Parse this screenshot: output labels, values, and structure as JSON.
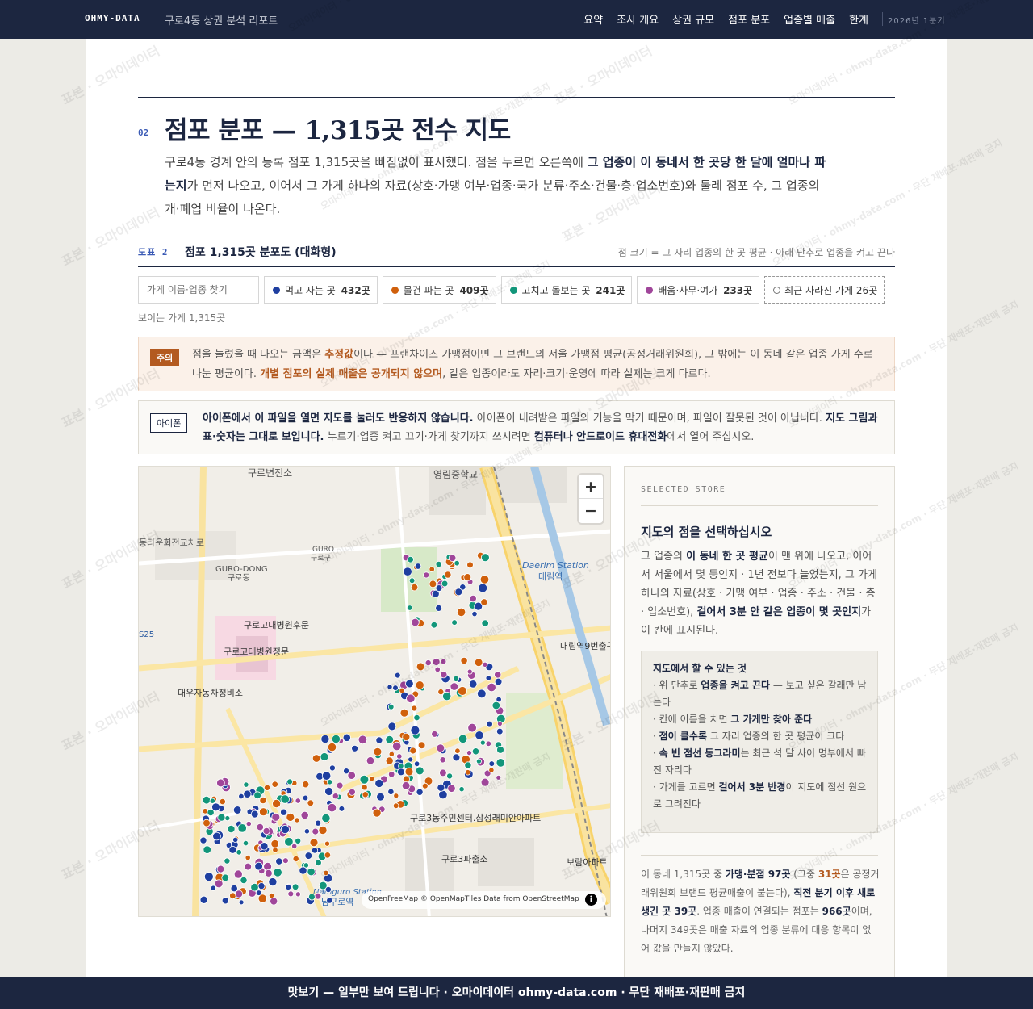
{
  "nav": {
    "brand": "OHMY-DATA",
    "subtitle": "구로4동 상권 분석 리포트",
    "links": [
      "요약",
      "조사 개요",
      "상권 규모",
      "점포 분포",
      "업종별 매출",
      "한계"
    ],
    "period": "2026년 1분기"
  },
  "section": {
    "number": "02",
    "title": "점포 분포 — 1,315곳 전수 지도",
    "desc_1": "구로4동 경계 안의 등록 점포 1,315곳을 빠짐없이 표시했다. 점을 누르면 오른쪽에 ",
    "desc_b1": "그 업종이 이 동네서 한 곳당 한 달에 얼마나 파는지",
    "desc_2": "가 먼저 나오고, 이어서 그 가게 하나의 자료(상호·가맹 여부·업종·국가 분류·주소·건물·층·업소번호)와 둘레 점포 수, 그 업종의 개·폐업 비율이 나온다."
  },
  "figure": {
    "label": "도표 2",
    "title": "점포 1,315곳 분포도 (대화형)",
    "note": "점 크기 = 그 자리 업종의 한 곳 평균 · 아래 단추로 업종을 켜고 끈다"
  },
  "search": {
    "placeholder": "가게 이름·업종 찾기"
  },
  "filters": [
    {
      "label": "먹고 자는 곳",
      "count": "432곳",
      "color": "#1f3fa0"
    },
    {
      "label": "물건 파는 곳",
      "count": "409곳",
      "color": "#d0600c"
    },
    {
      "label": "고치고 돌보는 곳",
      "count": "241곳",
      "color": "#12967a"
    },
    {
      "label": "배움·사무·여가",
      "count": "233곳",
      "color": "#a0469a"
    },
    {
      "label": "최근 사라진 가게",
      "count": "26곳"
    }
  ],
  "visible_count": "보이는 가게 1,315곳",
  "caution": {
    "tag": "주의",
    "t1": "점을 눌렀을 때 나오는 금액은 ",
    "b1": "추정값",
    "t2": "이다 — 프랜차이즈 가맹점이면 그 브랜드의 서울 가맹점 평균(공정거래위원회), 그 밖에는 이 동네 같은 업종 가게 수로 나눈 평균이다. ",
    "b2": "개별 점포의 실제 매출은 공개되지 않으며",
    "t3": ", 같은 업종이라도 자리·크기·운영에 따라 실제는 크게 다르다."
  },
  "iphone": {
    "tag": "아이폰",
    "b1": "아이폰에서 이 파일을 열면 지도를 눌러도 반응하지 않습니다.",
    "t1": " 아이폰이 내려받은 파일의 기능을 막기 때문이며, 파일이 잘못된 것이 아닙니다. ",
    "b2": "지도 그림과 표·숫자는 그대로 보입니다.",
    "t2": " 누르기·업종 켜고 끄기·가게 찾기까지 쓰시려면 ",
    "b3": "컴퓨터나 안드로이드 휴대전화",
    "t3": "에서 열어 주십시오."
  },
  "map": {
    "zoom_in": "+",
    "zoom_out": "−",
    "attribution": "OpenFreeMap © OpenMapTiles Data from OpenStreetMap",
    "labels": {
      "guro_station_area": "구로변전소",
      "youngrim": "영림중학교",
      "gurodong": "구로동",
      "guro_en": "GURO",
      "guro_kr": "구로구",
      "gurodong_en": "GURO-DONG",
      "daerim_station_en": "Daerim Station",
      "daerim_station_kr": "대림역",
      "hospital_back": "구로고대병원후문",
      "hospital_front": "구로고대병원정문",
      "s25": "S25",
      "daerim9": "대림역9번출구",
      "daewoo": "대우자동차정비소",
      "junction": "동타운회전교차로",
      "guroro": "구로로",
      "community": "구로3동주민센터.삼성래미안아파트",
      "guro3": "구로3파출소",
      "namguro": "Namguro Station",
      "namguro_kr": "남구로역",
      "apt": "보람아파트"
    }
  },
  "side": {
    "eyebrow": "SELECTED STORE",
    "title": "지도의 점을 선택하십시오",
    "b_t1": "그 업종의 ",
    "b_b1": "이 동네 한 곳 평균",
    "b_t2": "이 맨 위에 나오고, 이어서 서울에서 몇 등인지 · 1년 전보다 늘었는지, 그 가게 하나의 자료(상호 · 가맹 여부 · 업종 · 주소 · 건물 · 층 · 업소번호), ",
    "b_b2": "걸어서 3분 안 같은 업종이 몇 곳인지",
    "b_t3": "가 이 칸에 표시된다.",
    "todo_title": "지도에서 할 수 있는 것",
    "todo": [
      {
        "pre": "· 위 단추로 ",
        "b": "업종을 켜고 끈다",
        "post": " — 보고 싶은 갈래만 남는다"
      },
      {
        "pre": "· 칸에 이름을 치면 ",
        "b": "그 가게만 찾아 준다",
        "post": ""
      },
      {
        "pre": "· ",
        "b": "점이 클수록",
        "post": " 그 자리 업종의 한 곳 평균이 크다"
      },
      {
        "pre": "· ",
        "b": "속 빈 점선 동그라미",
        "post": "는 최근 석 달 사이 명부에서 빠진 자리다"
      },
      {
        "pre": "· 가게를 고르면 ",
        "b": "걸어서 3분 반경",
        "post": "이 지도에 점선 원으로 그려진다"
      }
    ],
    "s_t1": "이 동네 1,315곳 중 ",
    "s_b1": "가맹·분점 97곳",
    "s_t2": " (그중 ",
    "s_a1": "31곳",
    "s_t3": "은 공정거래위원회 브랜드 평균매출이 붙는다), ",
    "s_b2": "직전 분기 이후 새로 생긴 곳 39곳",
    "s_t4": ". 업종 매출이 연결되는 점포는 ",
    "s_b3": "966곳",
    "s_t5": "이며, 나머지 349곳은 매출 자료의 업종 분류에 대응 항목이 없어 값을 만들지 않았다."
  },
  "footer": "맛보기 — 일부만 보여 드립니다 · 오마이데이터 ohmy-data.com · 무단 재배포·재판매 금지",
  "watermark": [
    "표본 · 오마이데이터",
    "오마이데이터 · ohmy-data.com · 무단 재배포·재판매 금지"
  ]
}
